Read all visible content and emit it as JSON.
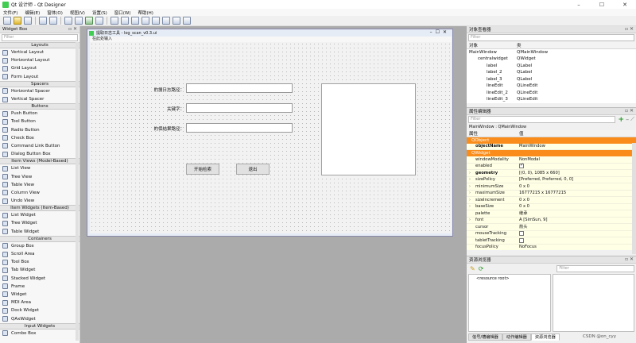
{
  "window": {
    "title": "Qt 设计师 - Qt Designer",
    "min": "–",
    "max": "☐",
    "close": "✕"
  },
  "menu": [
    "文件(F)",
    "编辑(E)",
    "窗体(O)",
    "视图(V)",
    "设置(S)",
    "窗口(W)",
    "帮助(H)"
  ],
  "widget_box": {
    "title": "Widget Box",
    "filter_placeholder": "Filter",
    "sections": [
      {
        "category": "Layouts",
        "items": [
          "Vertical Layout",
          "Horizontal Layout",
          "Grid Layout",
          "Form Layout"
        ]
      },
      {
        "category": "Spacers",
        "items": [
          "Horizontal Spacer",
          "Vertical Spacer"
        ]
      },
      {
        "category": "Buttons",
        "items": [
          "Push Button",
          "Tool Button",
          "Radio Button",
          "Check Box",
          "Command Link Button",
          "Dialog Button Box"
        ]
      },
      {
        "category": "Item Views (Model-Based)",
        "items": [
          "List View",
          "Tree View",
          "Table View",
          "Column View",
          "Undo View"
        ]
      },
      {
        "category": "Item Widgets (Item-Based)",
        "items": [
          "List Widget",
          "Tree Widget",
          "Table Widget"
        ]
      },
      {
        "category": "Containers",
        "items": [
          "Group Box",
          "Scroll Area",
          "Tool Box",
          "Tab Widget",
          "Stacked Widget",
          "Frame",
          "Widget",
          "MDI Area",
          "Dock Widget",
          "QAxWidget"
        ]
      },
      {
        "category": "Input Widgets",
        "items": [
          "Combo Box"
        ]
      }
    ]
  },
  "form": {
    "title": "提取日志工具 - log_scan_v0.3.ui",
    "menu_text": "在此处输入",
    "labels": [
      "的搜日志路径：",
      "关键字：",
      "的保结果路径："
    ],
    "buttons": {
      "start": "开始检索",
      "exit": "退出"
    }
  },
  "object_inspector": {
    "title": "对象查看器",
    "filter_placeholder": "Filter",
    "headers": [
      "对象",
      "类"
    ],
    "rows": [
      {
        "name": "MainWindow",
        "cls": "QMainWindow",
        "indent": 0
      },
      {
        "name": "centralwidget",
        "cls": "QWidget",
        "indent": 1
      },
      {
        "name": "label",
        "cls": "QLabel",
        "indent": 2
      },
      {
        "name": "label_2",
        "cls": "QLabel",
        "indent": 2
      },
      {
        "name": "label_3",
        "cls": "QLabel",
        "indent": 2
      },
      {
        "name": "lineEdit",
        "cls": "QLineEdit",
        "indent": 2
      },
      {
        "name": "lineEdit_2",
        "cls": "QLineEdit",
        "indent": 2
      },
      {
        "name": "lineEdit_3",
        "cls": "QLineEdit",
        "indent": 2
      }
    ]
  },
  "property_editor": {
    "title": "属性编辑器",
    "filter_placeholder": "Filter",
    "context": "MainWindow : QMainWindow",
    "headers": [
      "属性",
      "值"
    ],
    "sections": [
      {
        "name": "QObject",
        "rows": [
          {
            "prop": "objectName",
            "value": "MainWindow",
            "bold": true
          }
        ]
      },
      {
        "name": "QWidget",
        "rows": [
          {
            "prop": "windowModality",
            "value": "NonModal"
          },
          {
            "prop": "enabled",
            "value": "",
            "check": true
          },
          {
            "prop": "geometry",
            "value": "[(0, 0), 1085 x 660]",
            "bold": true,
            "expand": true
          },
          {
            "prop": "sizePolicy",
            "value": "[Preferred, Preferred, 0, 0]",
            "expand": true
          },
          {
            "prop": "minimumSize",
            "value": "0 x 0",
            "expand": true
          },
          {
            "prop": "maximumSize",
            "value": "16777215 x 16777215",
            "expand": true
          },
          {
            "prop": "sizeIncrement",
            "value": "0 x 0",
            "expand": true
          },
          {
            "prop": "baseSize",
            "value": "0 x 0",
            "expand": true
          },
          {
            "prop": "palette",
            "value": "继承"
          },
          {
            "prop": "font",
            "value": "A  [SimSun, 9]",
            "expand": true
          },
          {
            "prop": "cursor",
            "value": "箭头"
          },
          {
            "prop": "mouseTracking",
            "value": "",
            "check": false
          },
          {
            "prop": "tabletTracking",
            "value": "",
            "check": false
          },
          {
            "prop": "focusPolicy",
            "value": "NoFocus"
          }
        ]
      }
    ]
  },
  "resource_browser": {
    "title": "资源浏览器",
    "filter_placeholder": "Filter",
    "root": "<resource root>",
    "tabs": [
      "信号/槽编辑器",
      "动作编辑器",
      "资源浏览器"
    ]
  },
  "watermark": "CSDN @on_cyy"
}
